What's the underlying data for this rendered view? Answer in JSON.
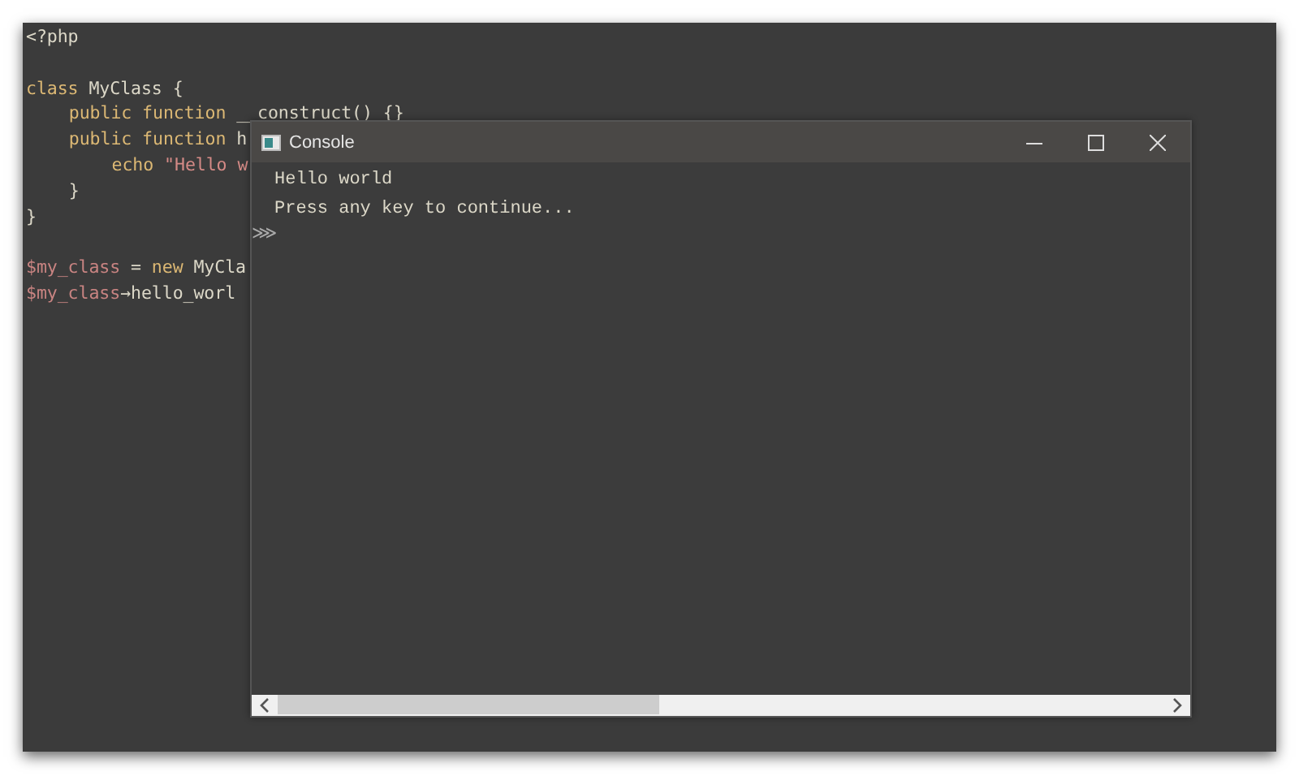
{
  "editor": {
    "lines": [
      {
        "tokens": [
          {
            "kind": "plain",
            "text": "<?php"
          }
        ]
      },
      {
        "spaced": true,
        "tokens": [
          {
            "kind": "keyword",
            "text": "class"
          },
          {
            "kind": "plain",
            "text": " MyClass {"
          }
        ],
        "children": [
          {
            "tokens": [
              {
                "kind": "keyword",
                "text": "public function"
              },
              {
                "kind": "plain",
                "text": " __construct() {}"
              }
            ]
          },
          {
            "tokens": [
              {
                "kind": "keyword",
                "text": "public function"
              },
              {
                "kind": "plain",
                "text": " h"
              }
            ],
            "children": [
              {
                "tokens": [
                  {
                    "kind": "keyword",
                    "text": "echo"
                  },
                  {
                    "kind": "string",
                    "text": " \"Hello w"
                  }
                ]
              }
            ]
          },
          {
            "tokens": [
              {
                "kind": "plain",
                "text": "}"
              }
            ]
          }
        ]
      },
      {
        "tokens": [
          {
            "kind": "plain",
            "text": "}"
          }
        ]
      },
      {
        "spaced": true,
        "tokens": [
          {
            "kind": "variable",
            "text": "$my_class"
          },
          {
            "kind": "plain",
            "text": " = "
          },
          {
            "kind": "keyword",
            "text": "new"
          },
          {
            "kind": "plain",
            "text": " MyCla"
          }
        ]
      },
      {
        "tokens": [
          {
            "kind": "variable",
            "text": "$my_class"
          },
          {
            "kind": "plain",
            "text": "→hello_worl"
          }
        ]
      }
    ]
  },
  "console": {
    "title": "Console",
    "output": [
      "Hello world",
      "Press any key to continue..."
    ],
    "prompt": "⋙"
  }
}
